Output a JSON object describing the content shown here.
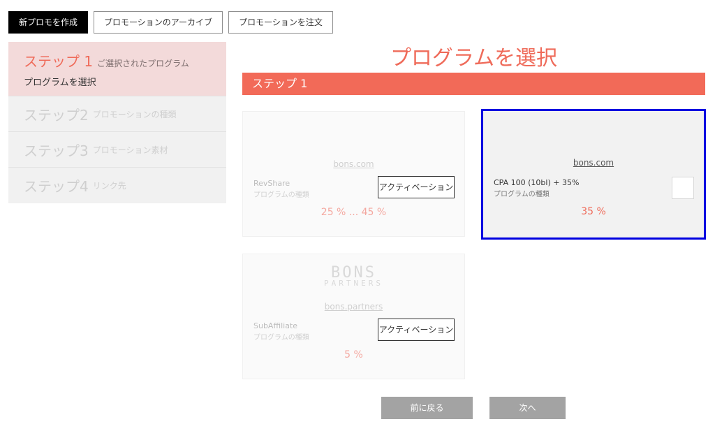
{
  "top_tabs": [
    {
      "label": "新プロモを作成",
      "active": true
    },
    {
      "label": "プロモーションのアーカイブ",
      "active": false
    },
    {
      "label": "プロモーションを注文",
      "active": false
    }
  ],
  "steps": [
    {
      "num": "ステップ 1",
      "desc": "ご選択されたプログラム",
      "sub": "プログラムを選択",
      "active": true
    },
    {
      "num": "ステップ2",
      "desc": "プロモーションの種類",
      "active": false
    },
    {
      "num": "ステップ3",
      "desc": "プロモーション素材",
      "active": false
    },
    {
      "num": "ステップ4",
      "desc": "リンク先",
      "active": false
    }
  ],
  "main": {
    "title": "プログラムを選択",
    "step_bar": "ステップ 1"
  },
  "programs": [
    {
      "site": "bons.com",
      "name": "RevShare",
      "type": "プログラムの種類",
      "percent": "25 % ... 45 %",
      "button": "アクティベーション",
      "selected": false
    },
    {
      "site": "bons.com",
      "name": "CPA 100 (10bl) + 35%",
      "type": "プログラムの種類",
      "percent": "35 %",
      "selected": true
    },
    {
      "site": "bons.partners",
      "logo_text": "BONS",
      "logo_sub": "PARTNERS",
      "name": "SubAffiliate",
      "type": "プログラムの種類",
      "percent": "5 %",
      "button": "アクティベーション",
      "selected": false
    }
  ],
  "nav": {
    "back": "前に戻る",
    "next": "次へ"
  },
  "colors": {
    "accent": "#f26a58",
    "selected_border": "#0000e0",
    "active_step_bg": "#f3dada",
    "button_gray": "#a3a3a3"
  }
}
